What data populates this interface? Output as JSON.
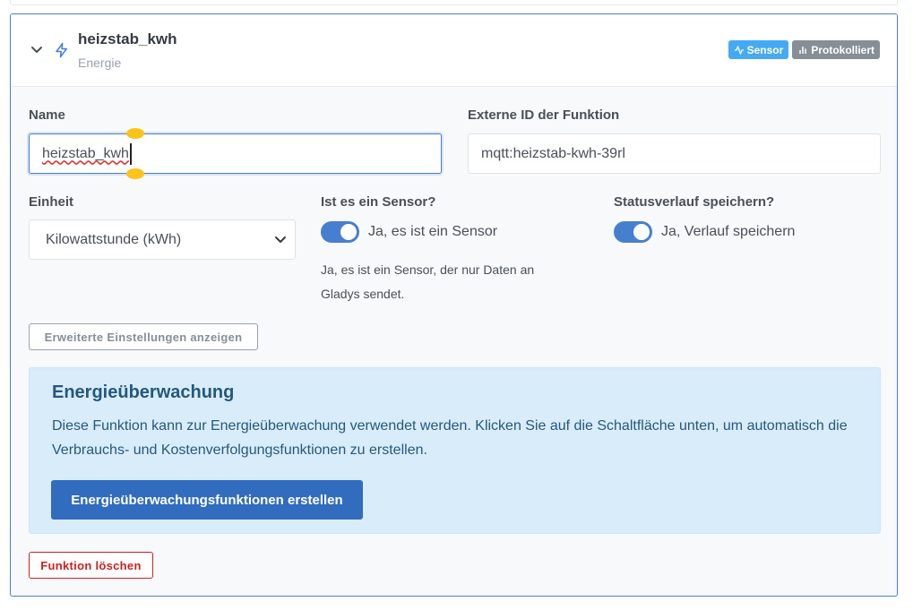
{
  "feature": {
    "title": "heizstab_kwh",
    "subtitle": "Energie",
    "badges": {
      "sensor": "Sensor",
      "logged": "Protokolliert"
    }
  },
  "form": {
    "name_label": "Name",
    "name_value": "heizstab_kwh",
    "external_id_label": "Externe ID der Funktion",
    "external_id_value": "mqtt:heizstab-kwh-39rl",
    "unit_label": "Einheit",
    "unit_value": "Kilowattstunde (kWh)",
    "sensor_label": "Ist es ein Sensor?",
    "sensor_toggle_label": "Ja, es ist ein Sensor",
    "sensor_hint": "Ja, es ist ein Sensor, der nur Daten an Gladys sendet.",
    "history_label": "Statusverlauf speichern?",
    "history_toggle_label": "Ja, Verlauf speichern",
    "advanced_button": "Erweiterte Einstellungen anzeigen"
  },
  "energy": {
    "title": "Energieüberwachung",
    "text": "Diese Funktion kann zur Energieüberwachung verwendet werden. Klicken Sie auf die Schaltfläche unten, um automatisch die Verbrauchs- und Kostenverfolgungsfunktionen zu erstellen.",
    "button": "Energieüberwachungsfunktionen erstellen"
  },
  "delete_button": "Funktion löschen",
  "colors": {
    "primary": "#467fcf",
    "sensor_badge": "#45aaf2",
    "logged_badge": "#868e96",
    "danger": "#cd201f",
    "info_bg": "#d9ecfa"
  }
}
